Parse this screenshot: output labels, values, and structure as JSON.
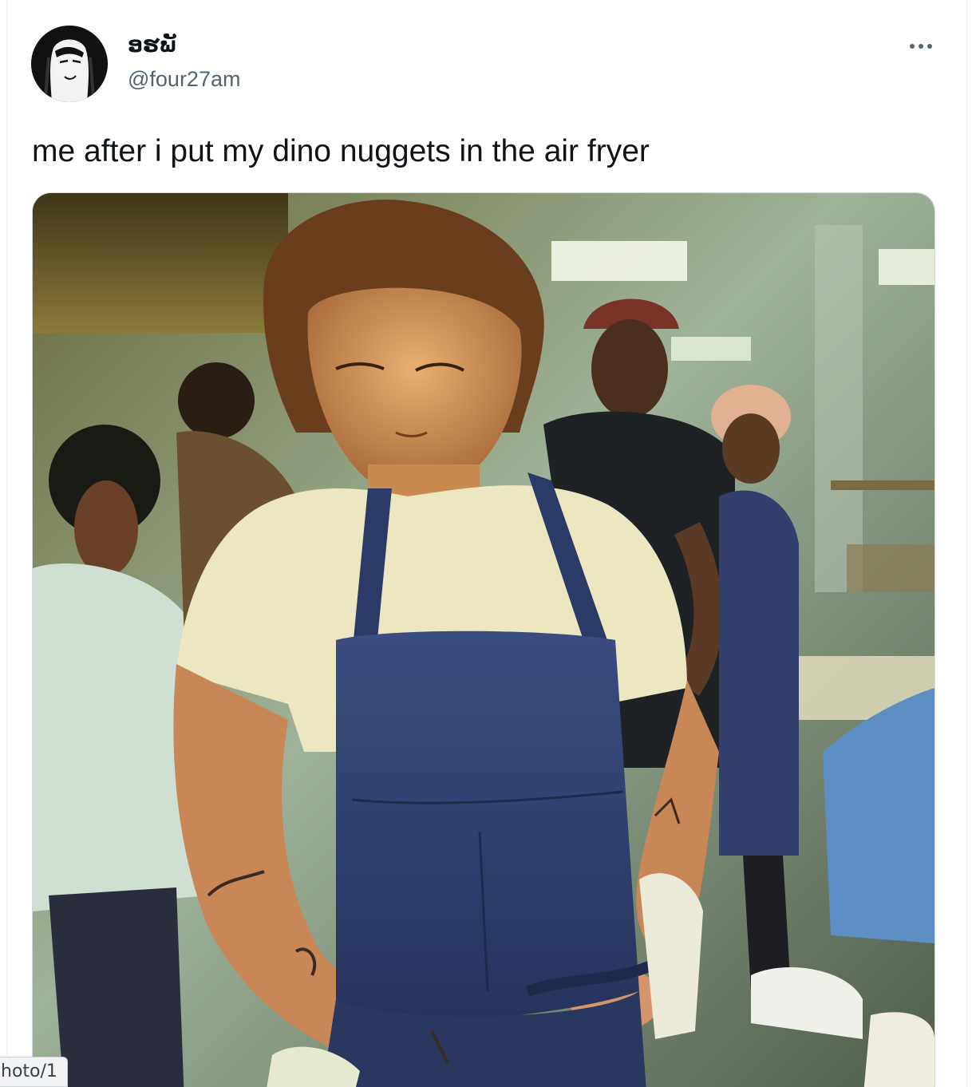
{
  "author": {
    "display_name": "ອຮພັ",
    "handle": "@four27am"
  },
  "tweet": {
    "text": "me after i put my dino nuggets in the air fryer"
  },
  "more_label": "More",
  "status_bar": {
    "url_fragment": "hoto/1"
  },
  "colors": {
    "text_primary": "#0f1419",
    "text_secondary": "#536471",
    "border": "#cfd9de",
    "apron_blue": "#2f3f6e",
    "shirt": "#ece7c0"
  }
}
